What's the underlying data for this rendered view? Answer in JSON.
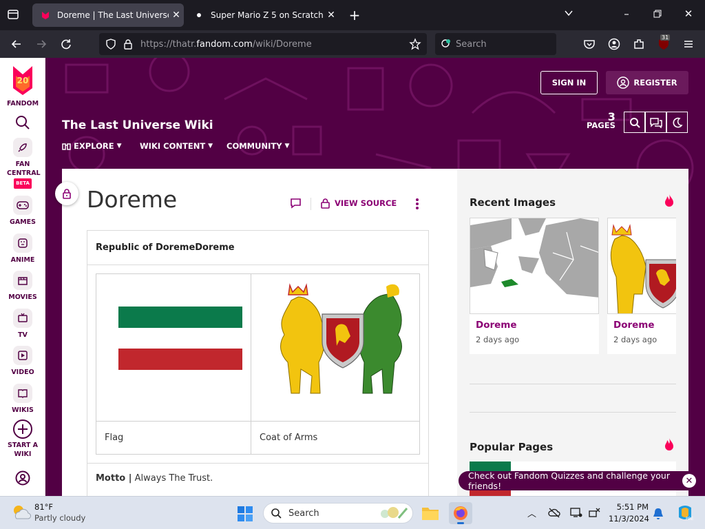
{
  "browser": {
    "tabs": [
      {
        "title": "Doreme | The Last Universe Wiki",
        "active": true
      },
      {
        "title": "Super Mario Z 5 on Scratch",
        "active": false
      }
    ],
    "url_prefix": "https://thatr.",
    "url_domain": "fandom.com",
    "url_path": "/wiki/Doreme",
    "search_placeholder": "Search",
    "extension_badge": "31"
  },
  "rail": {
    "logo_label": "FANDOM",
    "logo_number": "20",
    "items": [
      {
        "label": "FAN CENTRAL",
        "badge": "BETA"
      },
      {
        "label": "GAMES"
      },
      {
        "label": "ANIME"
      },
      {
        "label": "MOVIES"
      },
      {
        "label": "TV"
      },
      {
        "label": "VIDEO"
      },
      {
        "label": "WIKIS"
      },
      {
        "label": "START A WIKI"
      }
    ]
  },
  "wiki": {
    "name": "The Last Universe Wiki",
    "nav": [
      "EXPLORE",
      "WIKI CONTENT",
      "COMMUNITY"
    ],
    "sign_in": "SIGN IN",
    "register": "REGISTER",
    "pages_count": "3",
    "pages_label": "PAGES"
  },
  "article": {
    "title": "Doreme",
    "view_source": "VIEW SOURCE",
    "infobox": {
      "title": "Republic of DoremeDoreme",
      "captions": [
        "Flag",
        "Coat of Arms"
      ],
      "motto_label": "Motto |",
      "motto_value": " Always The Trust."
    }
  },
  "sidebar": {
    "recent_images_title": "Recent Images",
    "recent_images": [
      {
        "name": "Doreme",
        "time": "2 days ago"
      },
      {
        "name": "Doreme",
        "time": "2 days ago"
      }
    ],
    "popular_pages_title": "Popular Pages"
  },
  "quiz_banner": "Check out Fandom Quizzes and challenge your friends!",
  "taskbar": {
    "weather_temp": "81°F",
    "weather_desc": "Partly cloudy",
    "search_placeholder": "Search",
    "time": "5:51 PM",
    "date": "11/3/2024"
  },
  "colors": {
    "fandom_purple": "#520044",
    "link_magenta": "#8b0074",
    "flag_green": "#0b7a4b",
    "flag_red": "#c1272d"
  }
}
